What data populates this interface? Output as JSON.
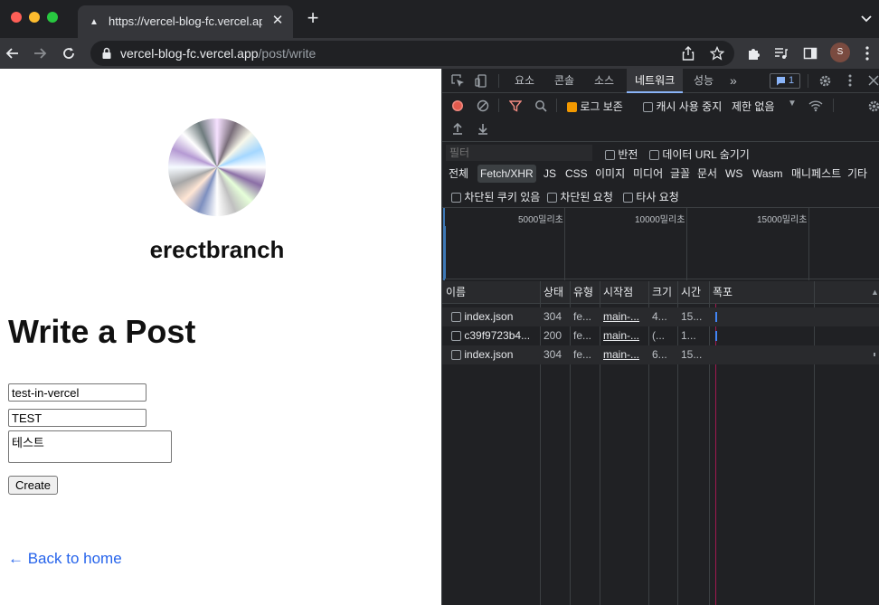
{
  "browser": {
    "tab_title": "https://vercel-blog-fc.vercel.app",
    "url_domain": "vercel-blog-fc.vercel.app",
    "url_path": "/post/write",
    "profile_initial": "S"
  },
  "page": {
    "blog_name": "erectbranch",
    "heading": "Write a Post",
    "form": {
      "slug_value": "test-in-vercel",
      "title_value": "TEST",
      "body_value": "테스트",
      "create_label": "Create"
    },
    "back_link": "← Back to home"
  },
  "devtools": {
    "tabs": [
      "요소",
      "콘솔",
      "소스",
      "네트워크",
      "성능"
    ],
    "active_tab": "네트워크",
    "issues_count": "1",
    "toolbar": {
      "preserve_log": "로그 보존",
      "disable_cache": "캐시 사용 중지",
      "throttle": "제한 없음"
    },
    "filter": {
      "placeholder": "필터",
      "invert": "반전",
      "hide_data_urls": "데이터 URL 숨기기"
    },
    "type_filters": [
      "전체",
      "Fetch/XHR",
      "JS",
      "CSS",
      "이미지",
      "미디어",
      "글꼴",
      "문서",
      "WS",
      "Wasm",
      "매니페스트",
      "기타"
    ],
    "active_type": "Fetch/XHR",
    "extra_filters": [
      "차단된 쿠키 있음",
      "차단된 요청",
      "타사 요청"
    ],
    "overview_ticks": [
      "5000밀리초",
      "10000밀리초",
      "15000밀리초"
    ],
    "columns": [
      "이름",
      "상태",
      "유형",
      "시작점",
      "크기",
      "시간",
      "폭포"
    ],
    "rows": [
      {
        "name": "index.json",
        "status": "304",
        "type": "fe...",
        "initiator": "main-...",
        "size": "4...",
        "time": "15..."
      },
      {
        "name": "c39f9723b4...",
        "status": "200",
        "type": "fe...",
        "initiator": "main-...",
        "size": "(...",
        "time": "1..."
      },
      {
        "name": "index.json",
        "status": "304",
        "type": "fe...",
        "initiator": "main-...",
        "size": "6...",
        "time": "15..."
      }
    ]
  }
}
